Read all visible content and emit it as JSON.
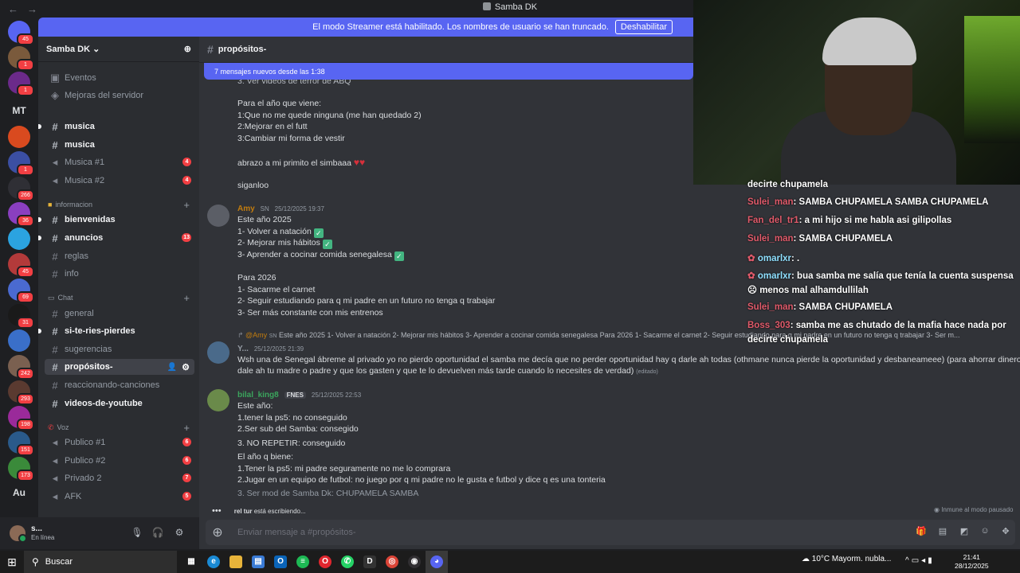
{
  "window": {
    "title": "Samba DK"
  },
  "banner": {
    "text": "El modo Streamer está habilitado. Los nombres de usuario se han truncado.",
    "button": "Deshabilitar"
  },
  "rail": {
    "badges": [
      "45",
      "1",
      "1",
      "1",
      "266",
      "36",
      "1",
      "45",
      "69",
      "31",
      "242",
      "293",
      "198",
      "151",
      "173"
    ],
    "texts": [
      "MT",
      "Au"
    ]
  },
  "server": {
    "name": "Samba DK"
  },
  "sidebar": {
    "top_items": [
      {
        "label": "Eventos"
      },
      {
        "label": "Mejoras del servidor"
      }
    ],
    "channels_a": [
      {
        "label": "musica",
        "mention": ""
      },
      {
        "label": "musica",
        "mention": ""
      },
      {
        "label": "Musica #1",
        "mention": "4"
      },
      {
        "label": "Musica #2",
        "mention": "4"
      }
    ],
    "category_info": "informacion",
    "channels_b": [
      {
        "label": "bienvenidas",
        "mention": ""
      },
      {
        "label": "anuncios",
        "mention": "13"
      },
      {
        "label": "reglas",
        "mention": ""
      },
      {
        "label": "info",
        "mention": ""
      }
    ],
    "category_chat": "Chat",
    "channels_c": [
      {
        "label": "general"
      },
      {
        "label": "si-te-ries-pierdes"
      },
      {
        "label": "sugerencias"
      },
      {
        "label": "propósitos-"
      },
      {
        "label": "reaccionando-canciones"
      },
      {
        "label": "videos-de-youtube"
      }
    ],
    "category_voz": "Voz",
    "voice": [
      {
        "label": "Publico #1",
        "mention": "6"
      },
      {
        "label": "Publico #2",
        "mention": "6"
      },
      {
        "label": "Privado 2",
        "mention": "7"
      },
      {
        "label": "AFK",
        "mention": "5"
      }
    ]
  },
  "user": {
    "name": "s...",
    "status": "En línea"
  },
  "channel": {
    "name": "propósitos-",
    "new_messages": "7 mensajes nuevos desde las 1:38"
  },
  "messages": {
    "m1": {
      "lines": [
        "3. Ver videos de terror de ABQ",
        "Para el año que viene:",
        "1:Que no me quede ninguna (me  han quedado 2)",
        "2:Mejorar en el futt",
        "3:Cambiar mi forma de vestir",
        "abrazo a mi primito el simbaaa",
        "siganloo"
      ]
    },
    "m2": {
      "author": "Amy",
      "tag": "SN",
      "time": "25/12/2025 19:37",
      "lines": [
        "Este año 2025",
        "1- Volver a natación",
        "2- Mejorar mis hábitos",
        "3- Aprender a cocinar comida senegalesa",
        "Para 2026",
        "1- Sacarme el carnet",
        "2- Seguir estudiando para q mi padre en un futuro no tenga q trabajar",
        "3- Ser más constante con mis entrenos"
      ]
    },
    "m3": {
      "reply_author": "@Amy",
      "reply_tag": "SN",
      "reply": "Este año 2025 1- Volver a natación   2- Mejorar mis hábitos   3- Aprender a cocinar comida senegalesa    Para 2026 1- Sacarme el carnet  2- Seguir estudiando para q mi padre en un futuro no tenga q trabajar 3- Ser m...",
      "author": "Y...",
      "time": "25/12/2025 21:39",
      "line1": "Wsh una de Senegal ábreme al privado yo no pierdo oportunidad el samba me decía que no perder oportunidad hay q darle ah todas (othmane nunca pierde la oportunidad y desbaneameee) (para ahorrar dinero",
      "line2": "dale ah tu madre o padre y que los gasten y que te lo devuelven más tarde cuando lo necesites de verdad)",
      "edited": "(editado)"
    },
    "m4": {
      "author": "bilal_king8",
      "tag": "FNES",
      "time": "25/12/2025 22:53",
      "lines": [
        "Este año:",
        "1.tener la ps5: no conseguido",
        "2.Ser sub del Samba: consegido",
        "3. NO REPETIR: conseguido",
        "El año q biene:",
        "1.Tener la ps5: mi padre seguramente no me lo comprara",
        "2.Jugar en un equipo de futbol: no juego por q mi padre no le gusta e futbol y dice q es una tonteria",
        "3. Ser mod de Samba Dk: CHUPAMELA SAMBA"
      ]
    }
  },
  "typing": {
    "user": "rel tur",
    "text": "está escribiendo..."
  },
  "slowmode": "Inmune al modo pausado",
  "input": {
    "placeholder": "Enviar mensaje a #propósitos-"
  },
  "livechat": [
    {
      "user": "",
      "msg": "decirte chupamela"
    },
    {
      "user": "Sulei_man",
      "msg": ": SAMBA CHUPAMELA SAMBA CHUPAMELA"
    },
    {
      "user": "Fan_del_tr1",
      "msg": ": a mi hijo si me habla asi gilipollas"
    },
    {
      "user": "Sulei_man",
      "msg": ": SAMBA CHUPAMELA"
    },
    {
      "user": "omarlxr",
      "msg": ": ."
    },
    {
      "user": "omarlxr",
      "msg": ": bua samba me salía que tenía la cuenta suspensa"
    },
    {
      "user": "",
      "msg": "menos mal alhamdullilah"
    },
    {
      "user": "Sulei_man",
      "msg": ": SAMBA CHUPAMELA"
    },
    {
      "user": "Boss_303",
      "msg": ": samba me as chutado de la mafia hace nada por"
    },
    {
      "user": "",
      "msg": "decirte chupamela"
    }
  ],
  "taskbar": {
    "search": "Buscar",
    "weather": "10°C  Mayorm. nubla...",
    "time": "21:41",
    "date": "28/12/2025"
  },
  "colors": {
    "accent": "#5865f2",
    "mention": "#f23f43",
    "online": "#23a55a",
    "amy": "#c27c0e",
    "bilal": "#3ba55d"
  }
}
